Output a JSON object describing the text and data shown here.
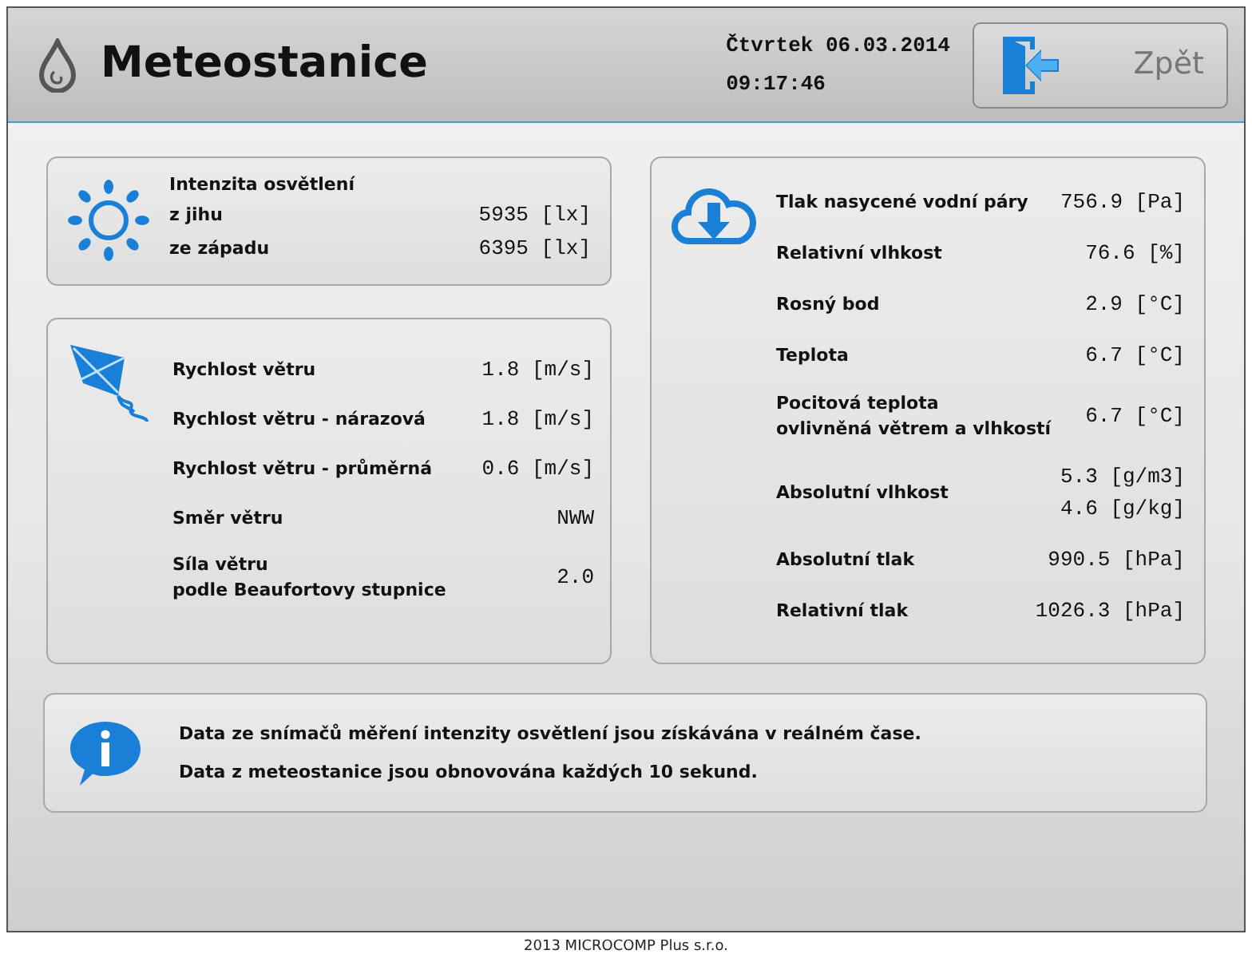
{
  "header": {
    "title": "Meteostanice",
    "date": "Čtvrtek 06.03.2014",
    "time": "09:17:46",
    "back_button": "Zpět"
  },
  "light_panel": {
    "title": "Intenzita osvětlení",
    "rows": [
      {
        "label": [
          "z jihu"
        ],
        "values": [
          "5935 [lx]"
        ]
      },
      {
        "label": [
          "ze západu"
        ],
        "values": [
          "6395 [lx]"
        ]
      }
    ]
  },
  "wind_panel": {
    "rows": [
      {
        "label": [
          "Rychlost větru"
        ],
        "values": [
          "1.8 [m/s]"
        ]
      },
      {
        "label": [
          "Rychlost větru - nárazová"
        ],
        "values": [
          "1.8 [m/s]"
        ]
      },
      {
        "label": [
          "Rychlost větru - průměrná"
        ],
        "values": [
          "0.6 [m/s]"
        ]
      },
      {
        "label": [
          "Směr větru"
        ],
        "values": [
          "NWW"
        ]
      },
      {
        "label": [
          "Síla větru",
          "podle Beaufortovy stupnice"
        ],
        "values": [
          "2.0"
        ]
      }
    ]
  },
  "humidity_panel": {
    "rows": [
      {
        "label": [
          "Tlak nasycené vodní páry"
        ],
        "values": [
          "756.9 [Pa]"
        ]
      },
      {
        "label": [
          "Relativní vlhkost"
        ],
        "values": [
          "76.6 [%]"
        ]
      },
      {
        "label": [
          "Rosný bod"
        ],
        "values": [
          "2.9 [°C]"
        ]
      },
      {
        "label": [
          "Teplota"
        ],
        "values": [
          "6.7 [°C]"
        ]
      },
      {
        "label": [
          "Pocitová teplota",
          "ovlivněná větrem a vlhkostí"
        ],
        "values": [
          "6.7 [°C]"
        ]
      },
      {
        "label": [
          "Absolutní vlhkost"
        ],
        "values": [
          "5.3 [g/m3]",
          "4.6 [g/kg]"
        ]
      },
      {
        "label": [
          "Absolutní tlak"
        ],
        "values": [
          "990.5 [hPa]"
        ]
      },
      {
        "label": [
          "Relativní tlak"
        ],
        "values": [
          "1026.3 [hPa]"
        ]
      }
    ]
  },
  "info_panel": {
    "lines": [
      "Data ze snímačů měření intenzity osvětlení jsou získávána v reálném čase.",
      "Data z meteostanice jsou obnovována každých 10 sekund."
    ]
  },
  "footer": "2013 MICROCOMP Plus s.r.o."
}
